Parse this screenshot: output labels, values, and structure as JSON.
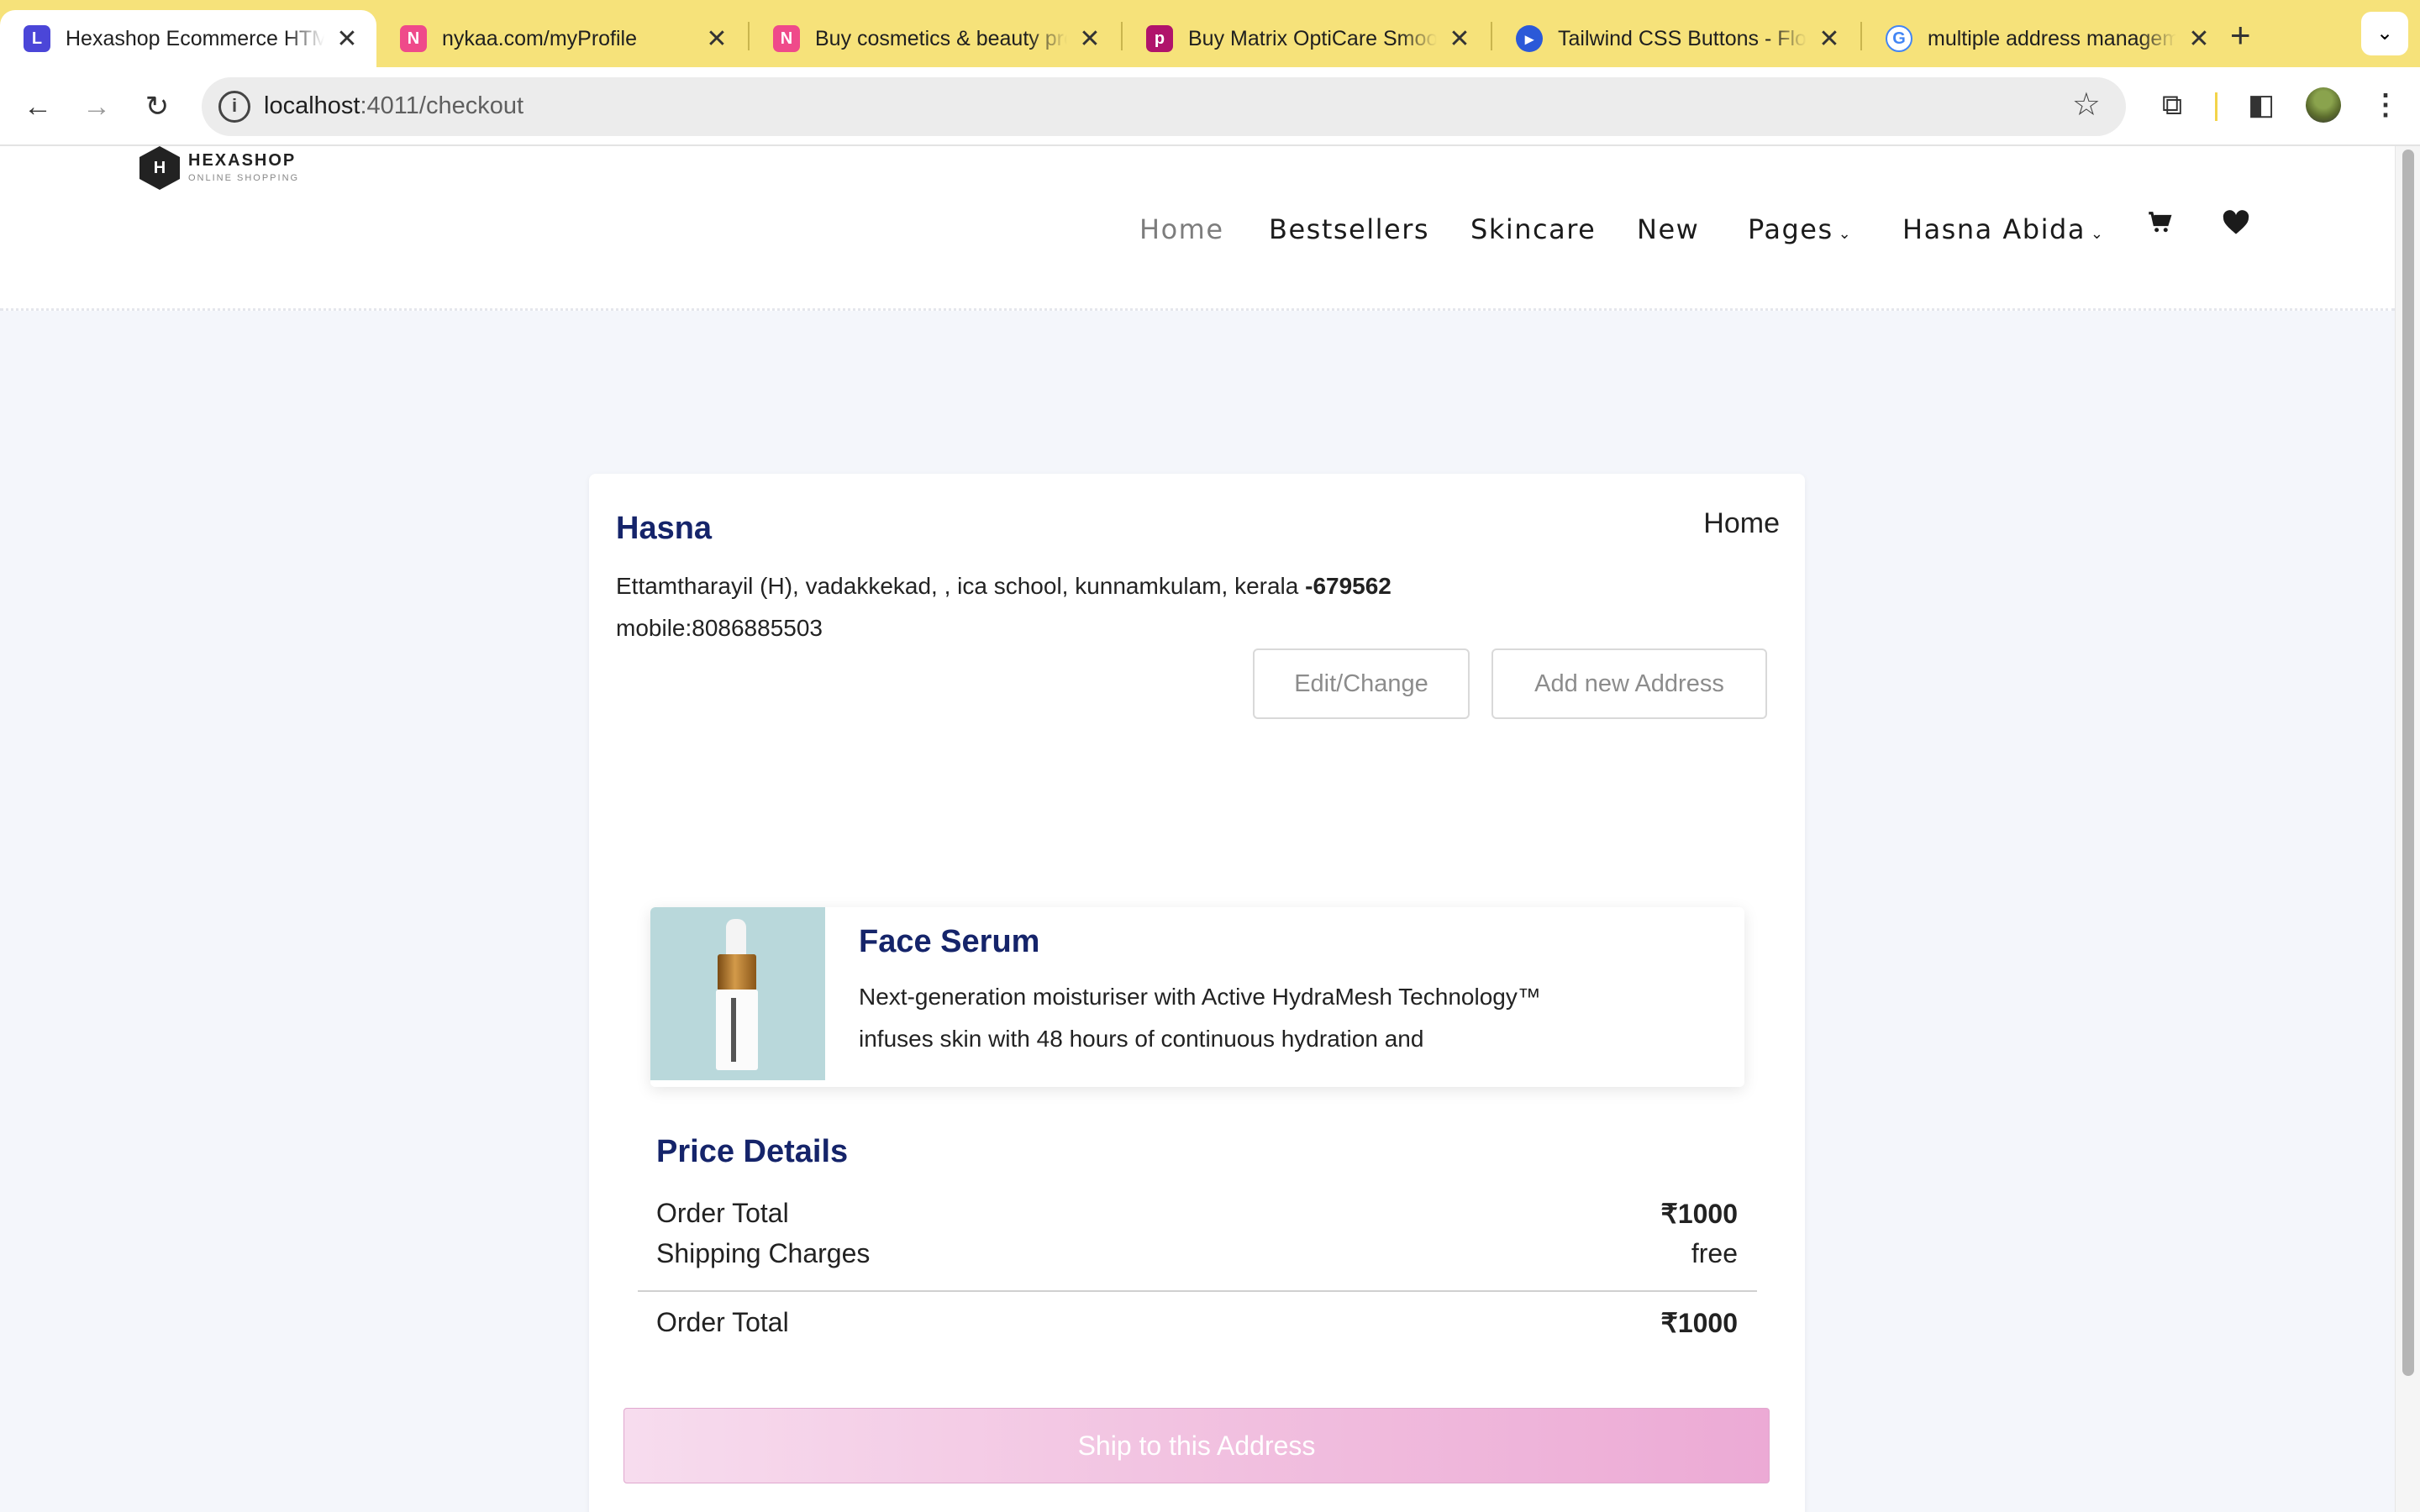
{
  "browser": {
    "tabs": [
      {
        "title": "Hexashop Ecommerce HTML",
        "favicon": "hexashop-favicon",
        "color": "#4b46d8",
        "active": true
      },
      {
        "title": "nykaa.com/myProfile",
        "favicon": "nykaa-favicon",
        "color": "#ef4a8a",
        "active": false
      },
      {
        "title": "Buy cosmetics & beauty products",
        "favicon": "nykaa-favicon",
        "color": "#ef4a8a",
        "active": false
      },
      {
        "title": "Buy Matrix OptiCare Smooth",
        "favicon": "purplle-favicon",
        "color": "#b0136b",
        "active": false
      },
      {
        "title": "Tailwind CSS Buttons - Flowbite",
        "favicon": "flowbite-favicon",
        "color": "#2b59d8",
        "active": false
      },
      {
        "title": "multiple address management",
        "favicon": "google-favicon",
        "color": "#4285f4",
        "active": false
      }
    ],
    "new_tab": "+",
    "url_host": "localhost",
    "url_path": ":4011/checkout"
  },
  "site": {
    "logo_letter": "H",
    "logo_name": "HEXASHOP",
    "logo_tagline": "ONLINE SHOPPING",
    "nav": {
      "home": "Home",
      "bestsellers": "Bestsellers",
      "skincare": "Skincare",
      "new": "New",
      "pages": "Pages",
      "user": "Hasna Abida"
    }
  },
  "address": {
    "name": "Hasna",
    "type": "Home",
    "line": "Ettamtharayil (H), vadakkekad, , ica school, kunnamkulam, kerala ",
    "pincode": "-679562",
    "mobile": "mobile:8086885503",
    "edit_label": "Edit/Change",
    "add_label": "Add new Address"
  },
  "product": {
    "name": "Face Serum",
    "description": "Next-generation moisturiser with Active HydraMesh Technology™ infuses skin with 48 hours of continuous hydration and"
  },
  "price": {
    "title": "Price Details",
    "order_total_label": "Order Total",
    "order_total_value": "₹1000",
    "shipping_label": "Shipping Charges",
    "shipping_value": "free",
    "grand_total_label": "Order Total",
    "grand_total_value": "₹1000"
  },
  "cta": {
    "ship_label": "Ship to this Address"
  },
  "colors": {
    "tab_strip": "#f6e27a",
    "heading": "#15246a",
    "cta_gradient_start": "#f7dcee",
    "cta_gradient_end": "#ecaad5",
    "page_bg": "#f4f6fb"
  }
}
